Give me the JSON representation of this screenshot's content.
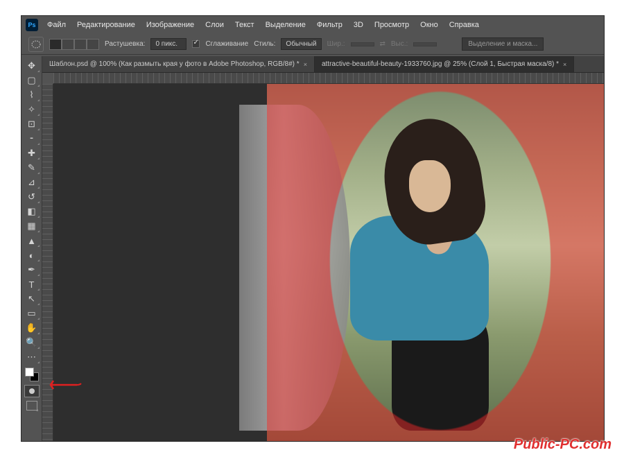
{
  "logo": "Ps",
  "menu": [
    "Файл",
    "Редактирование",
    "Изображение",
    "Слои",
    "Текст",
    "Выделение",
    "Фильтр",
    "3D",
    "Просмотр",
    "Окно",
    "Справка"
  ],
  "optbar": {
    "feather_label": "Растушевка:",
    "feather_value": "0 пикс.",
    "antialias_label": "Сглаживание",
    "style_label": "Стиль:",
    "style_value": "Обычный",
    "width_label": "Шир.:",
    "height_label": "Выс.:",
    "selectmask": "Выделение и маска..."
  },
  "tabs": [
    "Шаблон.psd @ 100% (Как размыть края у фото в Adobe Photoshop, RGB/8#) *",
    "attractive-beautiful-beauty-1933760.jpg @ 25% (Слой 1, Быстрая маска/8) *"
  ],
  "tools": [
    {
      "n": "move",
      "g": "✥"
    },
    {
      "n": "marquee",
      "g": "▢"
    },
    {
      "n": "lasso",
      "g": "⌇"
    },
    {
      "n": "magic-wand",
      "g": "✧"
    },
    {
      "n": "crop",
      "g": "⊡"
    },
    {
      "n": "eyedropper",
      "g": "⁃"
    },
    {
      "n": "healing",
      "g": "✚"
    },
    {
      "n": "brush",
      "g": "✎"
    },
    {
      "n": "stamp",
      "g": "⊿"
    },
    {
      "n": "history-brush",
      "g": "↺"
    },
    {
      "n": "eraser",
      "g": "◧"
    },
    {
      "n": "gradient",
      "g": "▦"
    },
    {
      "n": "blur",
      "g": "▲"
    },
    {
      "n": "dodge",
      "g": "◐"
    },
    {
      "n": "pen",
      "g": "✒"
    },
    {
      "n": "type",
      "g": "T"
    },
    {
      "n": "path-select",
      "g": "↖"
    },
    {
      "n": "rectangle",
      "g": "▭"
    },
    {
      "n": "hand",
      "g": "✋"
    },
    {
      "n": "zoom",
      "g": "🔍"
    },
    {
      "n": "edit-toolbar",
      "g": "⋯"
    }
  ],
  "watermark": "Public-PC.com"
}
